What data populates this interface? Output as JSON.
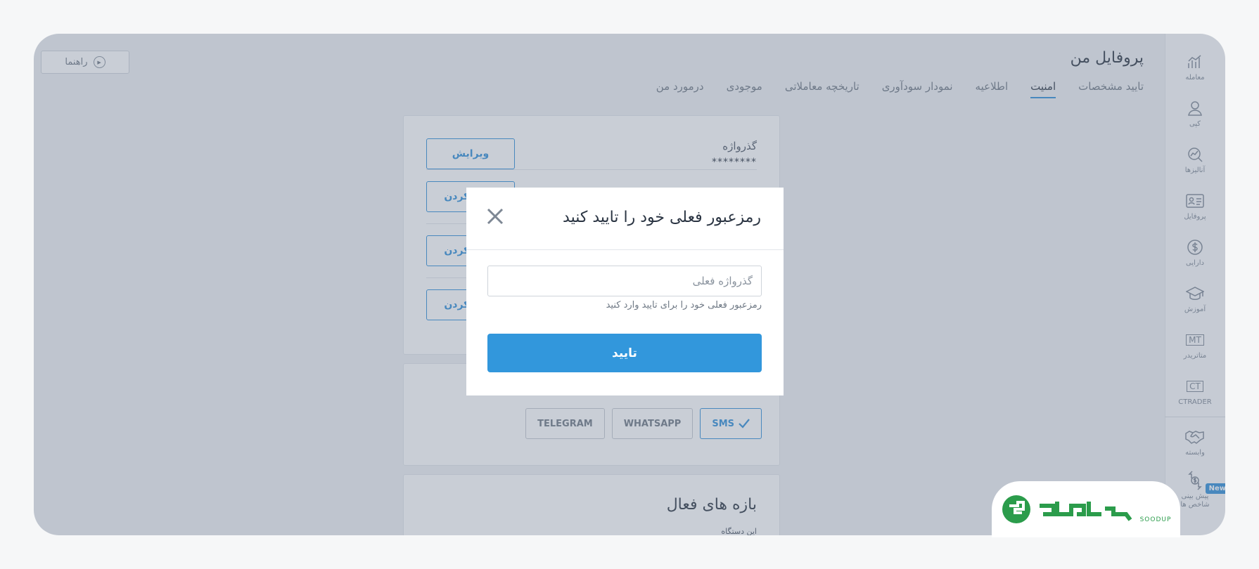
{
  "page": {
    "title": "پروفایل من",
    "guide_label": "راهنما"
  },
  "tabs": [
    {
      "label": "درمورد من",
      "active": false
    },
    {
      "label": "موجودی",
      "active": false
    },
    {
      "label": "تاریخچه معاملاتی",
      "active": false
    },
    {
      "label": "نمودار سودآوری",
      "active": false
    },
    {
      "label": "اطلاعیه",
      "active": false
    },
    {
      "label": "امنیت",
      "active": true
    },
    {
      "label": "تایید مشخصات",
      "active": false
    }
  ],
  "sidebar": {
    "items": [
      {
        "label": "معامله",
        "icon": "chart-icon"
      },
      {
        "label": "کپی",
        "icon": "user-icon"
      },
      {
        "label": "آنالیزها",
        "icon": "analysis-icon"
      },
      {
        "label": "پروفایل",
        "icon": "id-card-icon"
      },
      {
        "label": "دارایی",
        "icon": "dollar-icon"
      },
      {
        "label": "آموزش",
        "icon": "graduation-icon"
      },
      {
        "label": "متاتریدر",
        "icon": "mt-icon",
        "glyph": "MT"
      },
      {
        "label": "CTRADER",
        "icon": "ct-icon",
        "glyph": "CT"
      },
      {
        "label": "وابسته",
        "icon": "handshake-icon"
      },
      {
        "label": "پیش بینی شاخص ها",
        "icon": "forecast-icon"
      }
    ],
    "new_badge": "New"
  },
  "security": {
    "password_label": "گذرواژه",
    "password_value": "********",
    "edit_button": "ویرایش",
    "enable_buttons": [
      "فعال کردن",
      "فعال کردن",
      "فعال کردن"
    ],
    "channels": [
      {
        "label": "SMS",
        "active": true
      },
      {
        "label": "WHATSAPP",
        "active": false
      },
      {
        "label": "TELEGRAM",
        "active": false
      }
    ],
    "sessions_title": "بازه های فعال",
    "sessions_sub": "این دستگاه"
  },
  "modal": {
    "title": "رمزعبور فعلی خود را تایید کنید",
    "input_placeholder": "گذرواژه فعلی",
    "hint": "رمزعبور فعلی خود را برای تایید وارد کنید",
    "confirm_button": "تایید"
  },
  "logo": {
    "text": "SOODUP"
  },
  "colors": {
    "accent": "#3297dc",
    "logo_green": "#2b9c4b"
  }
}
